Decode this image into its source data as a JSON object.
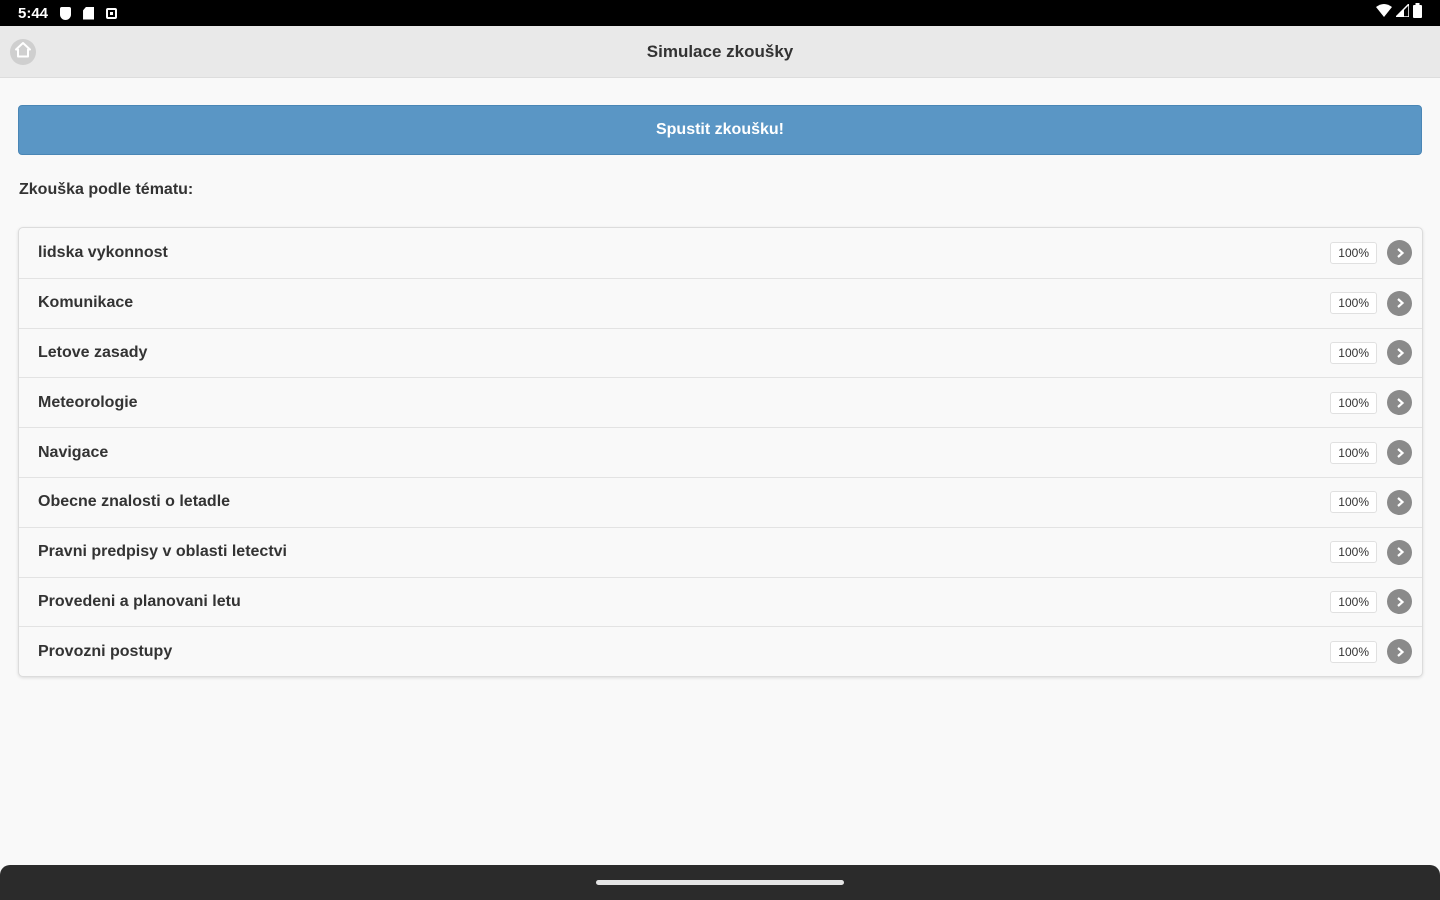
{
  "status_bar": {
    "time": "5:44",
    "left_icons": [
      "shield-icon",
      "sd-card-icon",
      "notification-icon"
    ],
    "right_icons": [
      "wifi-icon",
      "cell-signal-icon",
      "battery-icon"
    ]
  },
  "header": {
    "title": "Simulace zkoušky",
    "home_icon": "home-icon"
  },
  "start_button": {
    "label": "Spustit zkoušku!",
    "color": "#5a96c5"
  },
  "topics_section": {
    "label": "Zkouška podle tématu:",
    "items": [
      {
        "name": "lidska vykonnost",
        "percent": "100%"
      },
      {
        "name": "Komunikace",
        "percent": "100%"
      },
      {
        "name": "Letove zasady",
        "percent": "100%"
      },
      {
        "name": "Meteorologie",
        "percent": "100%"
      },
      {
        "name": "Navigace",
        "percent": "100%"
      },
      {
        "name": "Obecne znalosti o letadle",
        "percent": "100%"
      },
      {
        "name": "Pravni predpisy v oblasti letectvi",
        "percent": "100%"
      },
      {
        "name": "Provedeni a planovani letu",
        "percent": "100%"
      },
      {
        "name": "Provozni postupy",
        "percent": "100%"
      }
    ]
  }
}
